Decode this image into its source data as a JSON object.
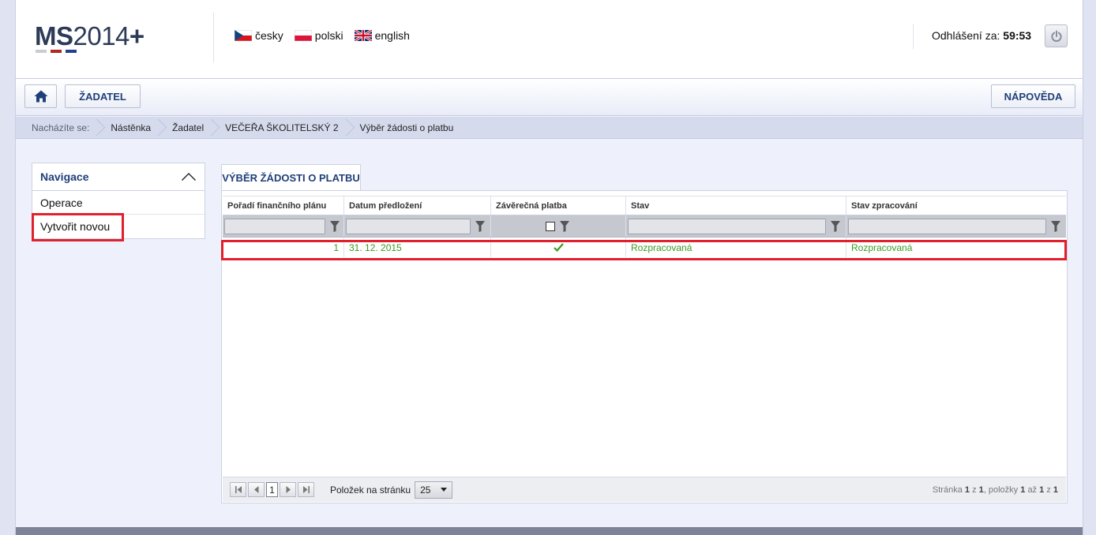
{
  "header": {
    "logo": {
      "ms": "MS",
      "year": "2014",
      "plus": "+"
    },
    "languages": [
      {
        "label": "česky"
      },
      {
        "label": "polski"
      },
      {
        "label": "english"
      }
    ],
    "logout_label": "Odhlášení za:",
    "logout_timer": "59:53"
  },
  "toolbar": {
    "home_icon": "home-icon",
    "zadatel_label": "ŽADATEL",
    "help_label": "NÁPOVĚDA"
  },
  "breadcrumb": {
    "label": "Nacházíte se:",
    "items": [
      "Nástěnka",
      "Žadatel",
      "VEČEŘA ŠKOLITELSKÝ 2",
      "Výběr žádosti o platbu"
    ]
  },
  "navigation": {
    "title": "Navigace",
    "items": [
      "Operace",
      "Vytvořit novou"
    ]
  },
  "tab": {
    "label": "VÝBĚR ŽÁDOSTI O PLATBU"
  },
  "grid": {
    "columns": [
      "Pořadí finančního plánu",
      "Datum předložení",
      "Závěrečná platba",
      "Stav",
      "Stav zpracování"
    ],
    "rows": [
      {
        "poradi": "1",
        "datum": "31. 12. 2015",
        "zaverecna": true,
        "stav": "Rozpracovaná",
        "stav_zpracovani": "Rozpracovaná"
      }
    ]
  },
  "pager": {
    "current_page": "1",
    "per_page_label": "Položek na stránku",
    "per_page_value": "25",
    "info_prefix": "Stránka",
    "info_page": "1",
    "info_of": "z",
    "info_total_pages": "1",
    "info_items": ", položky",
    "info_from": "1",
    "info_to_word": "až",
    "info_to": "1",
    "info_total_items": "1"
  },
  "colors": {
    "accent": "#1f3f7a",
    "status_green": "#3c9a20",
    "highlight": "#e0202d"
  }
}
